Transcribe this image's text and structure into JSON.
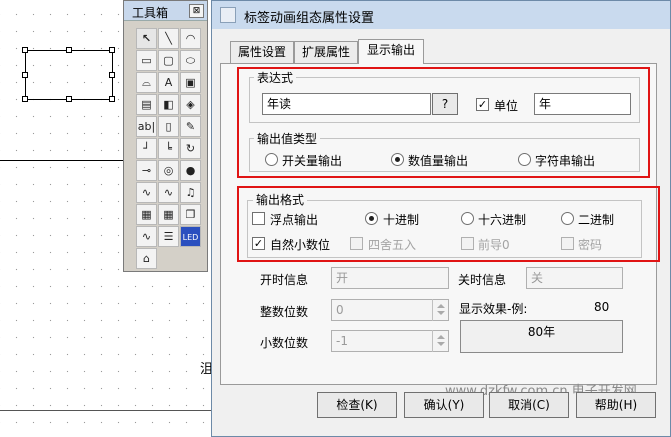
{
  "toolbox": {
    "title": "工具箱",
    "close_label": "⊠",
    "tools": [
      {
        "icon": "pointer-icon",
        "glyph": "↖"
      },
      {
        "icon": "line-icon",
        "glyph": "╲"
      },
      {
        "icon": "arc-icon",
        "glyph": "◠"
      },
      {
        "icon": "rectangle-icon",
        "glyph": "▭"
      },
      {
        "icon": "rounded-rectangle-icon",
        "glyph": "▢"
      },
      {
        "icon": "ellipse-icon",
        "glyph": "⬭"
      },
      {
        "icon": "polygon-icon",
        "glyph": "⌓"
      },
      {
        "icon": "text-icon",
        "glyph": "A"
      },
      {
        "icon": "image-icon",
        "glyph": "▣"
      },
      {
        "icon": "button-icon",
        "glyph": "▤"
      },
      {
        "icon": "symbol-icon",
        "glyph": "◧"
      },
      {
        "icon": "shape-library-icon",
        "glyph": "◈"
      },
      {
        "icon": "input-box-icon",
        "glyph": "ab|"
      },
      {
        "icon": "scale-icon",
        "glyph": "▯"
      },
      {
        "icon": "pen-icon",
        "glyph": "✎"
      },
      {
        "icon": "connector-icon",
        "glyph": "┘"
      },
      {
        "icon": "flow-line-icon",
        "glyph": "╘"
      },
      {
        "icon": "rotate-icon",
        "glyph": "↻"
      },
      {
        "icon": "key-icon",
        "glyph": "⊸"
      },
      {
        "icon": "dial-icon",
        "glyph": "◎"
      },
      {
        "icon": "indicator-icon",
        "glyph": "●"
      },
      {
        "icon": "trend-chart-icon",
        "glyph": "∿"
      },
      {
        "icon": "history-chart-icon",
        "glyph": "∿"
      },
      {
        "icon": "alarm-bell-icon",
        "glyph": "♫"
      },
      {
        "icon": "grid-table-icon",
        "glyph": "▦"
      },
      {
        "icon": "report-table-icon",
        "glyph": "▦"
      },
      {
        "icon": "copy-icon",
        "glyph": "❐"
      },
      {
        "icon": "curve-chart-icon",
        "glyph": "∿"
      },
      {
        "icon": "list-icon",
        "glyph": "☰"
      },
      {
        "icon": "led-display-icon",
        "glyph": "LED"
      },
      {
        "icon": "frame-icon",
        "glyph": "⌂"
      }
    ]
  },
  "dialog": {
    "title": "标签动画组态属性设置",
    "tabs": [
      "属性设置",
      "扩展属性",
      "显示输出"
    ],
    "expression": {
      "group_label": "表达式",
      "value": "年读",
      "browse_label": "?",
      "unit_checkbox_label": "单位",
      "unit_checked": true,
      "unit_value": "年"
    },
    "output_type": {
      "group_label": "输出值类型",
      "options": [
        "开关量输出",
        "数值量输出",
        "字符串输出"
      ],
      "selected": 1
    },
    "format": {
      "group_label": "输出格式",
      "float_label": "浮点输出",
      "float_checked": false,
      "natural_decimal_label": "自然小数位",
      "natural_decimal_checked": true,
      "radix_options": [
        "十进制",
        "十六进制",
        "二进制"
      ],
      "radix_selected": 0,
      "round_label": "四舍五入",
      "leading_zero_label": "前导0",
      "password_label": "密码"
    },
    "on_label": "开时信息",
    "on_value": "开",
    "off_label": "关时信息",
    "off_value": "关",
    "integer_digits_label": "整数位数",
    "integer_digits_value": "0",
    "decimal_digits_label": "小数位数",
    "decimal_digits_value": "-1",
    "preview_label": "显示效果-例:",
    "preview_number": "80",
    "preview_display": "80年",
    "buttons": {
      "check": "检查(K)",
      "ok": "确认(Y)",
      "cancel": "取消(C)",
      "help": "帮助(H)"
    }
  },
  "canvas_fragment_text": "沮",
  "watermark": "www.dzkfw.com.cn 电子开发网"
}
